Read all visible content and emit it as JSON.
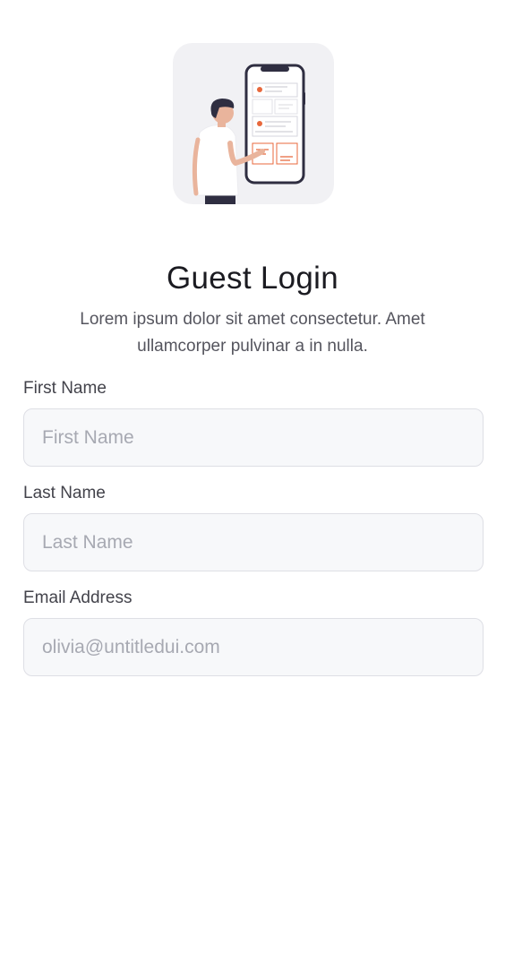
{
  "illustration": {
    "icon": "person-with-phone-illustration",
    "accent_color": "#e8683c",
    "background_color": "#f1f1f4"
  },
  "header": {
    "title": "Guest Login",
    "subtitle": "Lorem ipsum dolor sit amet consectetur. Amet ullamcorper pulvinar a in nulla."
  },
  "form": {
    "first_name": {
      "label": "First Name",
      "value": "",
      "placeholder": "First Name"
    },
    "last_name": {
      "label": "Last Name",
      "value": "",
      "placeholder": "Last Name"
    },
    "email": {
      "label": "Email Address",
      "value": "",
      "placeholder": "olivia@untitledui.com"
    }
  }
}
